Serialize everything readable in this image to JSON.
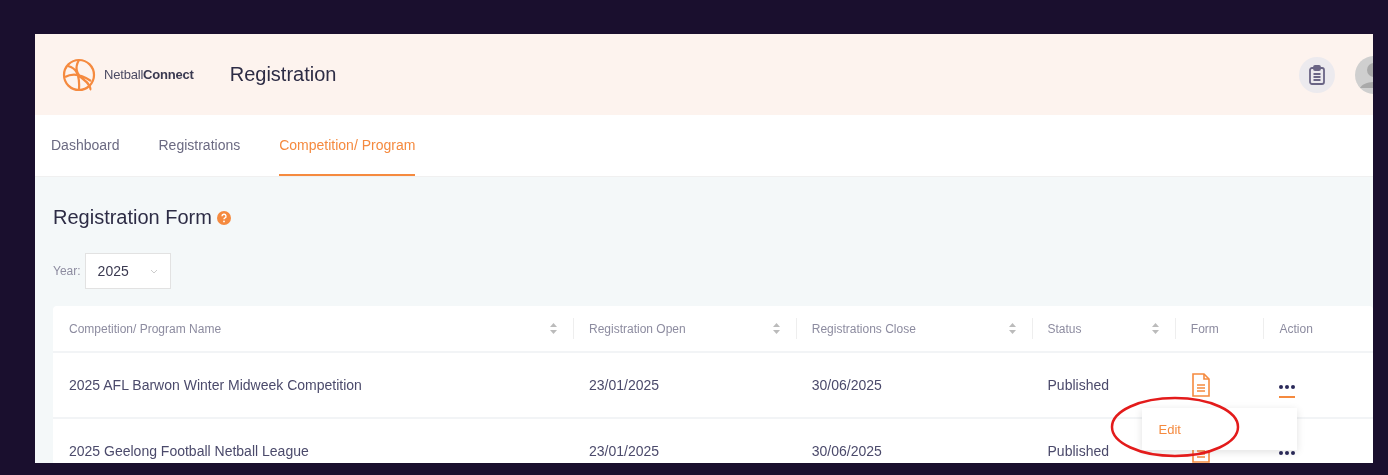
{
  "header": {
    "brand_light": "Netball",
    "brand_bold": "Connect",
    "title": "Registration"
  },
  "tabs": [
    {
      "label": "Dashboard",
      "selected": false
    },
    {
      "label": "Registrations",
      "selected": false
    },
    {
      "label": "Competition/ Program",
      "selected": true
    }
  ],
  "page_title": "Registration Form",
  "year_filter": {
    "label": "Year:",
    "value": "2025"
  },
  "table": {
    "columns": [
      {
        "label": "Competition/ Program Name",
        "sortable": true
      },
      {
        "label": "Registration Open",
        "sortable": true
      },
      {
        "label": "Registrations Close",
        "sortable": true
      },
      {
        "label": "Status",
        "sortable": true
      },
      {
        "label": "Form",
        "sortable": false
      },
      {
        "label": "Action",
        "sortable": false
      }
    ],
    "rows": [
      {
        "name": "2025 AFL Barwon Winter Midweek Competition",
        "open": "23/01/2025",
        "close": "30/06/2025",
        "status": "Published",
        "menu_open": true
      },
      {
        "name": "2025 Geelong Football Netball League",
        "open": "23/01/2025",
        "close": "30/06/2025",
        "status": "Published",
        "menu_open": false
      }
    ]
  },
  "action_menu": {
    "items": [
      "Edit"
    ]
  }
}
